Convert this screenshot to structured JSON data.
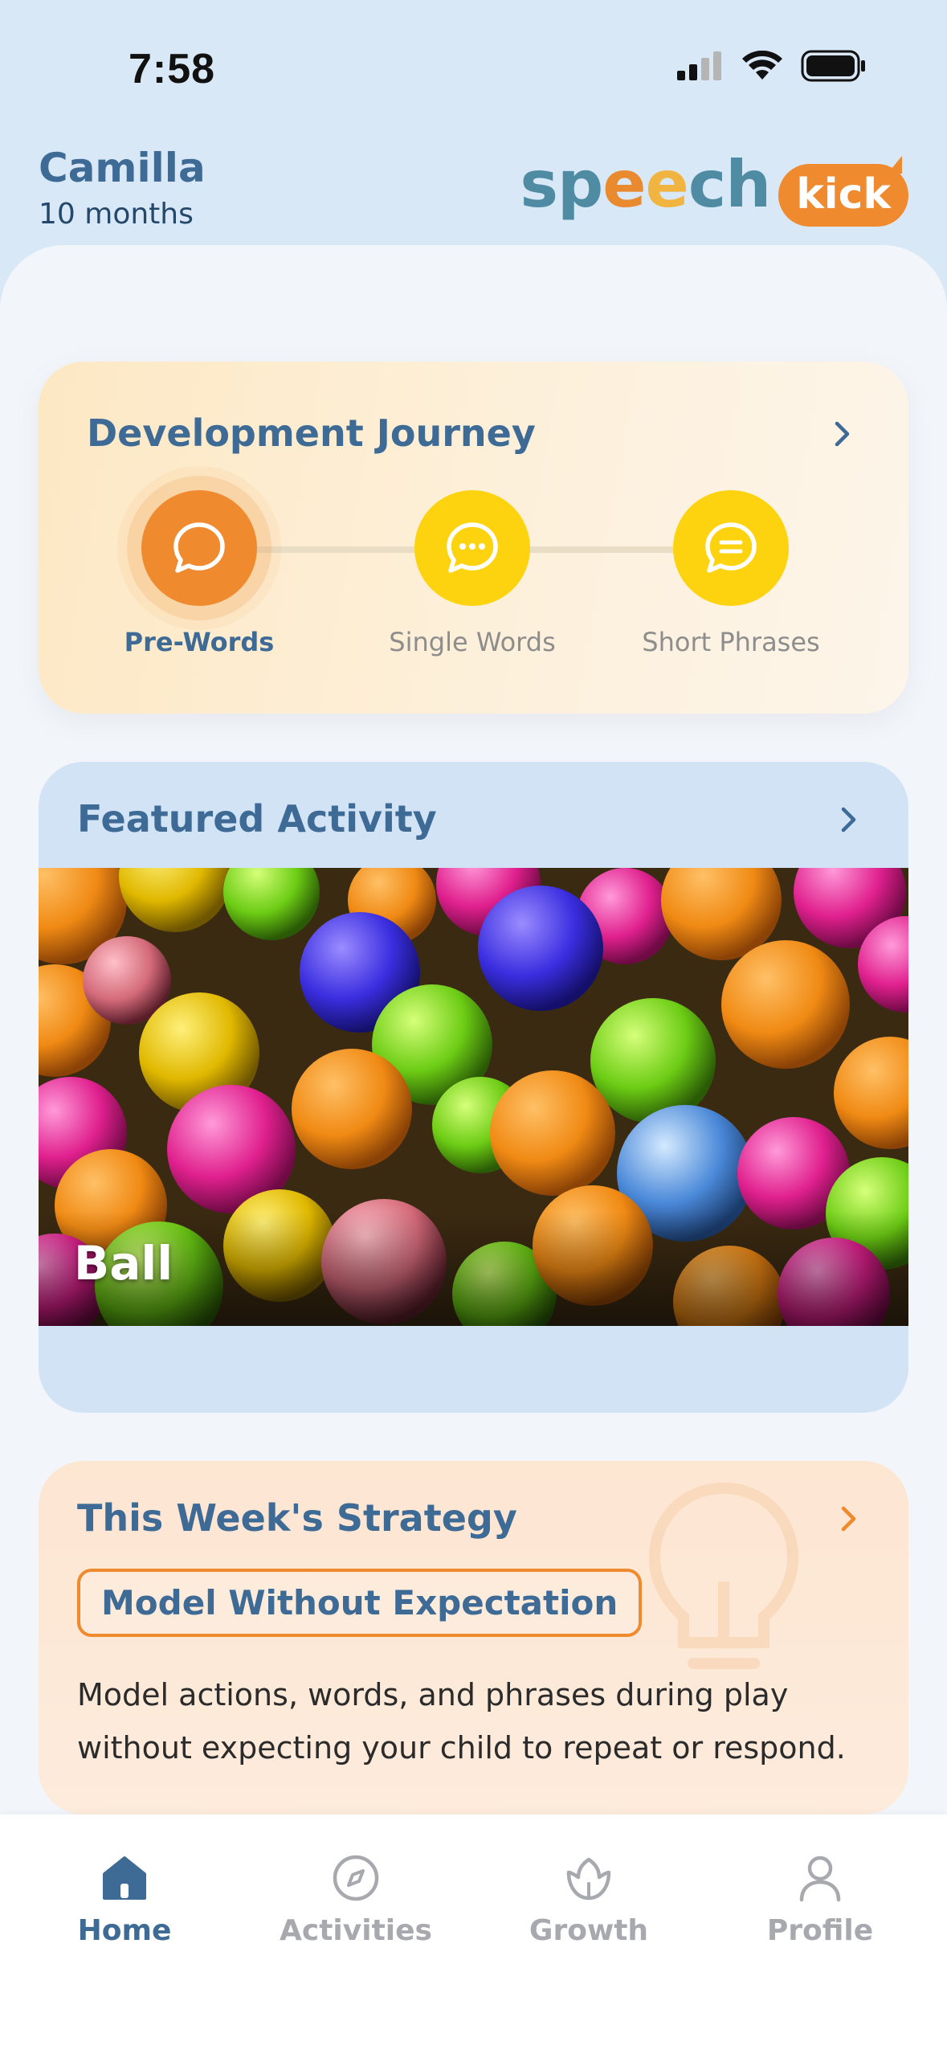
{
  "status_bar": {
    "time": "7:58"
  },
  "header": {
    "child_name": "Camilla",
    "child_age": "10 months",
    "logo": {
      "part1": "sp",
      "part2": "e",
      "part3": "e",
      "part4": "ch",
      "badge": "kick"
    }
  },
  "journey": {
    "title": "Development Journey",
    "steps": [
      {
        "label": "Pre-Words",
        "icon": "speech-bubble-icon",
        "active": true
      },
      {
        "label": "Single Words",
        "icon": "speech-bubble-dots-icon",
        "active": false
      },
      {
        "label": "Short Phrases",
        "icon": "speech-bubble-lines-icon",
        "active": false
      }
    ]
  },
  "featured": {
    "title": "Featured Activity",
    "activity_label": "Ball"
  },
  "strategy": {
    "title": "This Week's Strategy",
    "badge": "Model Without Expectation",
    "text": "Model actions, words, and phrases during play without expecting your child to repeat or respond."
  },
  "tabs": [
    {
      "label": "Home",
      "icon": "home-icon",
      "active": true
    },
    {
      "label": "Activities",
      "icon": "compass-icon",
      "active": false
    },
    {
      "label": "Growth",
      "icon": "flower-icon",
      "active": false
    },
    {
      "label": "Profile",
      "icon": "person-icon",
      "active": false
    }
  ],
  "colors": {
    "primary": "#3e6a96",
    "accent_orange": "#ef8a2e",
    "accent_yellow": "#fdd30f",
    "background": "#d9e8f6"
  }
}
